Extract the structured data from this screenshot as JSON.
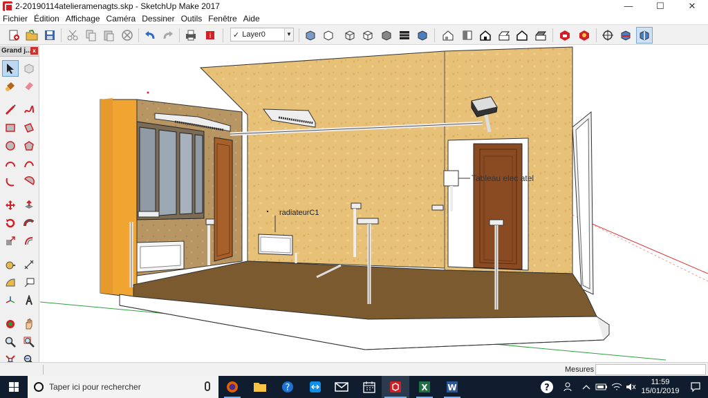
{
  "window": {
    "title": "2-20190114atelieramenagts.skp - SketchUp Make 2017",
    "controls": {
      "minimize": "—",
      "maximize": "☐",
      "close": "✕"
    }
  },
  "menu": [
    "Fichier",
    "Édition",
    "Affichage",
    "Caméra",
    "Dessiner",
    "Outils",
    "Fenêtre",
    "Aide"
  ],
  "toolbar": {
    "layer_check": "✓",
    "layer_value": "Layer0"
  },
  "panel": {
    "title": "Grand j...",
    "close": "x"
  },
  "viewport": {
    "labels": {
      "radiator": "radiateurC1",
      "panel": "Tableau elec atel"
    }
  },
  "statusbar": {
    "measure_label": "Mesures",
    "measure_value": ""
  },
  "taskbar": {
    "search_placeholder": "Taper ici pour rechercher",
    "time": "11:59",
    "date": "15/01/2019",
    "excel_letter": "X",
    "word_letter": "W"
  },
  "colors": {
    "wall": "#e9c377",
    "floor": "#7a5a2e",
    "door": "#8a4a22",
    "taskbar": "#0f1d2e",
    "accent_red": "#d21f26"
  }
}
